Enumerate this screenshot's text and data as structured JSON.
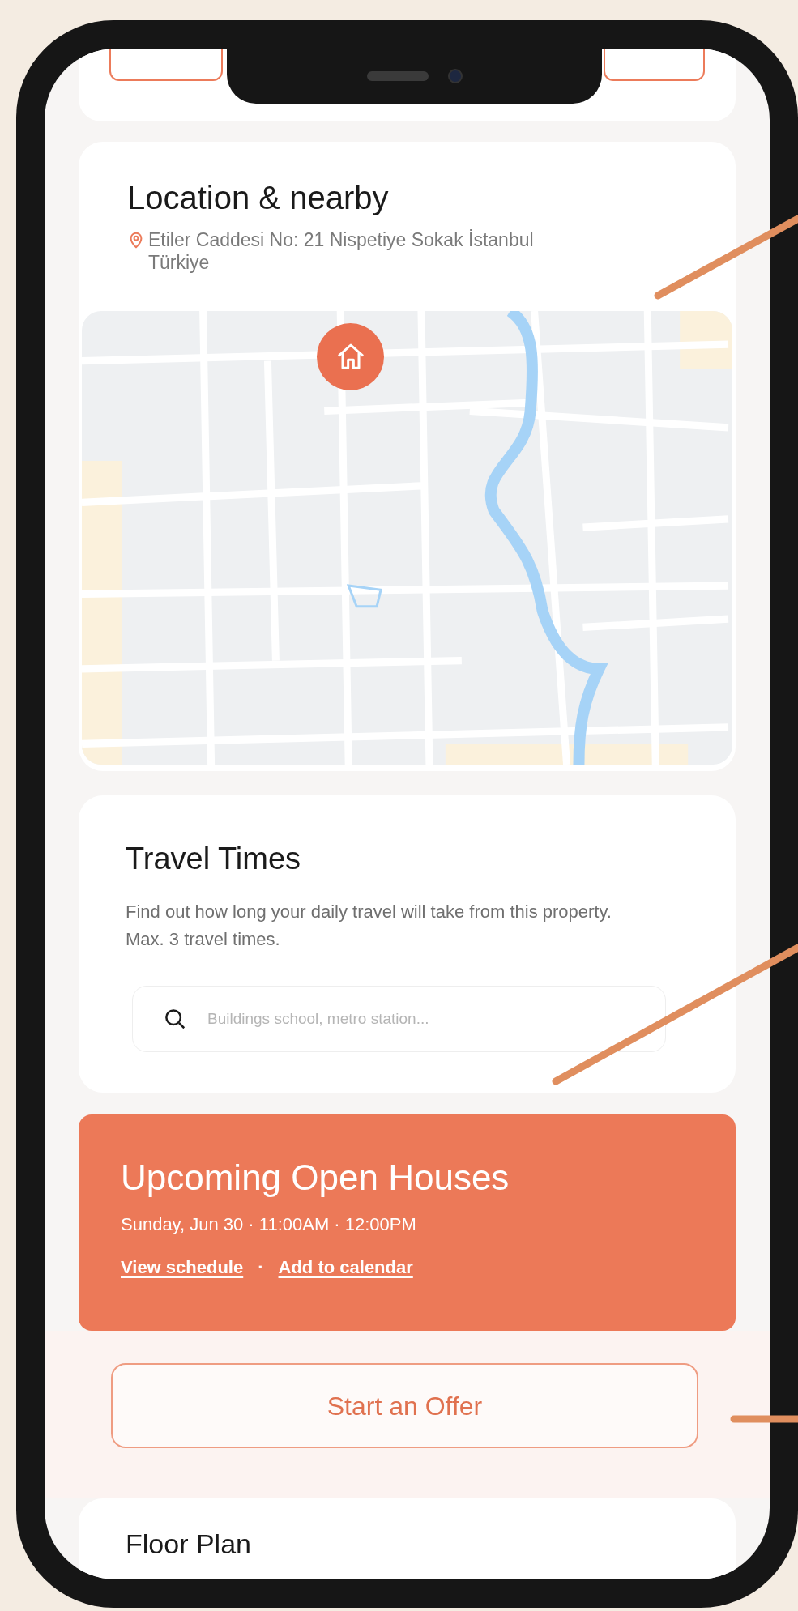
{
  "location": {
    "title": "Location & nearby",
    "address": "Etiler Caddesi No: 21 Nispetiye Sokak İstanbul Türkiye"
  },
  "travel_times": {
    "title": "Travel Times",
    "description": "Find out how long your daily travel will take from this property. Max. 3 travel times.",
    "search": {
      "placeholder": "Buildings school, metro station..."
    }
  },
  "open_houses": {
    "title": "Upcoming Open Houses",
    "date": "Sunday, Jun 30 · 11:00AM · 12:00PM",
    "links": [
      "View schedule",
      "Add to calendar"
    ],
    "separator": "·"
  },
  "offer_button": "Start an Offer",
  "floor_plan": {
    "title": "Floor Plan"
  }
}
